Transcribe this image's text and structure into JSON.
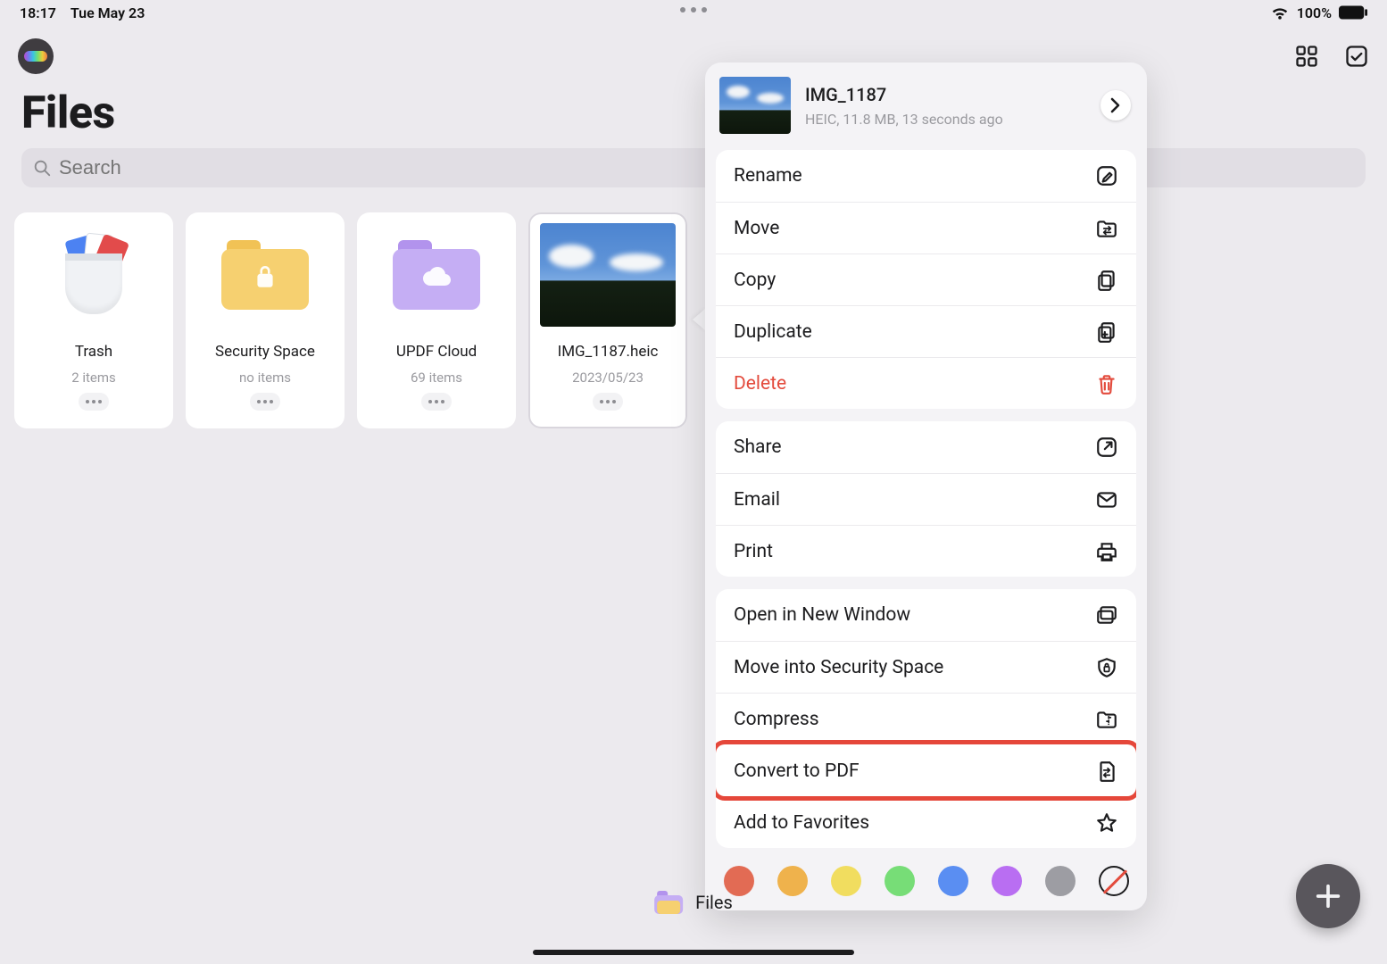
{
  "status": {
    "time": "18:17",
    "date": "Tue May 23",
    "battery": "100%"
  },
  "header": {
    "title": "Files"
  },
  "search": {
    "placeholder": "Search"
  },
  "grid": [
    {
      "name": "Trash",
      "sub": "2 items"
    },
    {
      "name": "Security Space",
      "sub": "no items"
    },
    {
      "name": "UPDF Cloud",
      "sub": "69 items"
    },
    {
      "name": "IMG_1187.heic",
      "sub": "2023/05/23"
    }
  ],
  "context": {
    "file_title": "IMG_1187",
    "file_sub": "HEIC, 11.8 MB, 13 seconds ago",
    "groups": [
      [
        {
          "key": "rename",
          "label": "Rename"
        },
        {
          "key": "move",
          "label": "Move"
        },
        {
          "key": "copy",
          "label": "Copy"
        },
        {
          "key": "duplicate",
          "label": "Duplicate"
        },
        {
          "key": "delete",
          "label": "Delete",
          "destructive": true
        }
      ],
      [
        {
          "key": "share",
          "label": "Share"
        },
        {
          "key": "email",
          "label": "Email"
        },
        {
          "key": "print",
          "label": "Print"
        }
      ],
      [
        {
          "key": "new_window",
          "label": "Open in New Window"
        },
        {
          "key": "move_security",
          "label": "Move into Security Space"
        },
        {
          "key": "compress",
          "label": "Compress"
        },
        {
          "key": "convert_pdf",
          "label": "Convert to PDF",
          "highlighted": true
        },
        {
          "key": "favorite",
          "label": "Add to Favorites"
        }
      ]
    ],
    "colors": [
      "#e26b54",
      "#efb24c",
      "#f1dd5f",
      "#77dd77",
      "#5a8ef2",
      "#b96ef2",
      "#9d9da3"
    ]
  },
  "bottom": {
    "label": "Files"
  }
}
